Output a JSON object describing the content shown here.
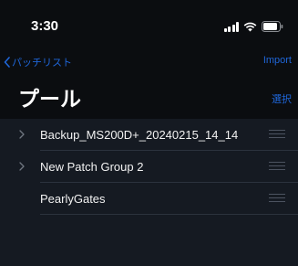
{
  "status_bar": {
    "time": "3:30",
    "icons": [
      "signal-icon",
      "wifi-icon",
      "battery-icon"
    ]
  },
  "nav": {
    "back_label": "パッチリスト",
    "import_label": "Import"
  },
  "header": {
    "title": "プール",
    "select_label": "選択"
  },
  "list": {
    "items": [
      {
        "label": "Backup_MS200D+_20240215_14_14",
        "has_chevron": true
      },
      {
        "label": "New Patch Group 2",
        "has_chevron": true
      },
      {
        "label": "PearlyGates",
        "has_chevron": false
      }
    ]
  },
  "colors": {
    "accent": "#1f66d9",
    "background": "#151a22",
    "header_background": "#0b0d10"
  }
}
